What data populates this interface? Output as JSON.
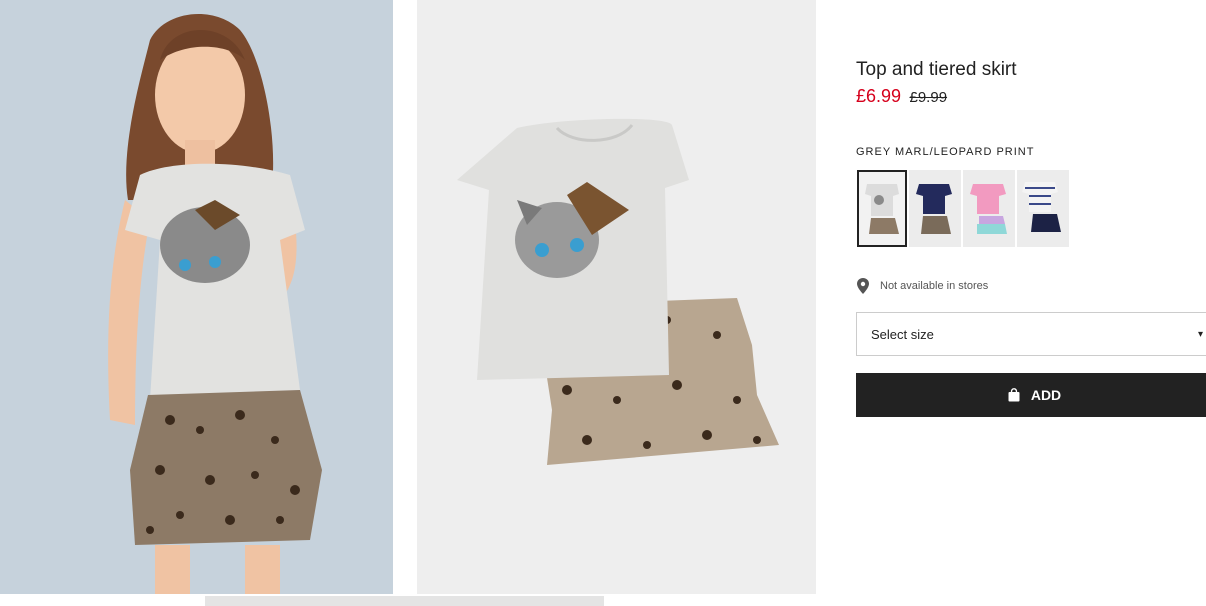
{
  "product": {
    "title": "Top and tiered skirt",
    "price_sale": "£6.99",
    "price_original": "£9.99",
    "color_name": "GREY MARL/LEOPARD PRINT",
    "availability": "Not available in stores",
    "size_placeholder": "Select size",
    "add_label": "ADD"
  },
  "swatches": [
    {
      "name": "grey-marl-leopard",
      "selected": true
    },
    {
      "name": "navy-love",
      "selected": false
    },
    {
      "name": "pink-unicorn",
      "selected": false
    },
    {
      "name": "striped-navy",
      "selected": false
    }
  ],
  "colors": {
    "sale_red": "#d6001c",
    "button_black": "#222222",
    "model_backdrop": "#c6d2dc",
    "flatlay_backdrop": "#eeeeee"
  },
  "icons": {
    "location": "map-pin-icon",
    "size_dropdown": "chevron-down-icon",
    "add_button": "shopping-bag-icon"
  }
}
